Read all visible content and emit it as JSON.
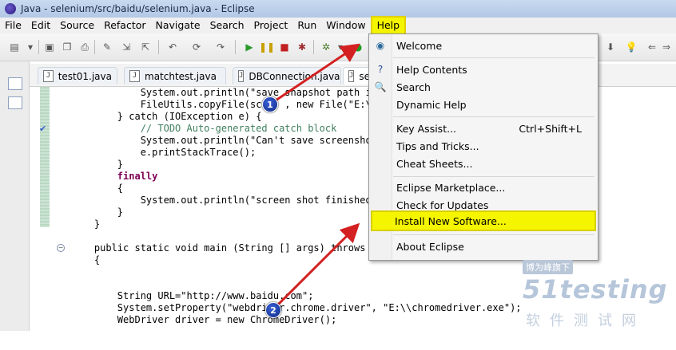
{
  "window": {
    "title": "Java - selenium/src/baidu/selenium.java - Eclipse"
  },
  "menubar": [
    "File",
    "Edit",
    "Source",
    "Refactor",
    "Navigate",
    "Search",
    "Project",
    "Run",
    "Window",
    "Help"
  ],
  "tabs": [
    "test01.java",
    "matchtest.java",
    "DBConnection.java",
    "se"
  ],
  "code_lines": [
    "            System.out.println(\"save snapshot path is:",
    "            FileUtils.copyFile(scrF  , new File(\"E:\\\\",
    "        } catch (IOException e) {",
    "            // TODO Auto-generated catch block",
    "            System.out.println(\"Can't save screenshot\"",
    "            e.printStackTrace();",
    "        }",
    "        finally",
    "        {",
    "            System.out.println(\"screen shot finished\")",
    "        }",
    "    }",
    "",
    "    public static void main (String [] args) throws In",
    "    {",
    "",
    "",
    "        String URL=\"http://www.baidu.com\";",
    "        System.setProperty(\"webdriver.chrome.driver\", \"E:\\\\chromedriver.exe\");",
    "        WebDriver driver = new ChromeDriver();"
  ],
  "help_menu": {
    "welcome": "Welcome",
    "help_contents": "Help Contents",
    "search": "Search",
    "dynamic_help": "Dynamic Help",
    "key_assist": "Key Assist...",
    "key_assist_shortcut": "Ctrl+Shift+L",
    "tips_tricks": "Tips and Tricks...",
    "cheat_sheets": "Cheat Sheets...",
    "marketplace": "Eclipse Marketplace...",
    "check_updates": "Check for Updates",
    "install_software": "Install New Software...",
    "about": "About Eclipse"
  },
  "annotations": {
    "one": "1",
    "two": "2"
  },
  "watermark": {
    "top": "博为峰旗下",
    "brand": "51testing",
    "cn": "软件测试网"
  },
  "colors": {
    "highlight": "#f5f500",
    "arrow": "#d42020",
    "badge": "#1d3a9e"
  }
}
